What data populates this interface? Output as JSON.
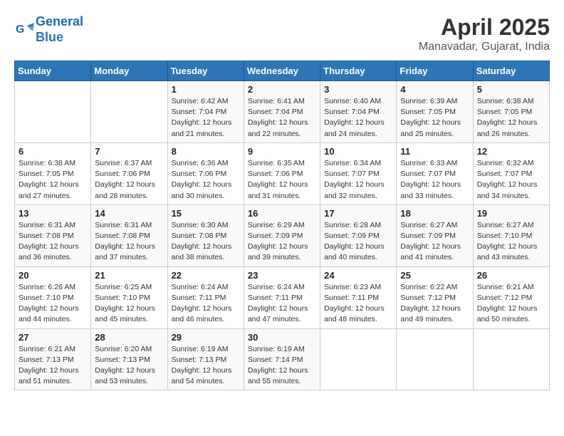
{
  "header": {
    "logo_line1": "General",
    "logo_line2": "Blue",
    "month": "April 2025",
    "location": "Manavadar, Gujarat, India"
  },
  "weekdays": [
    "Sunday",
    "Monday",
    "Tuesday",
    "Wednesday",
    "Thursday",
    "Friday",
    "Saturday"
  ],
  "weeks": [
    [
      {
        "day": "",
        "info": ""
      },
      {
        "day": "",
        "info": ""
      },
      {
        "day": "1",
        "info": "Sunrise: 6:42 AM\nSunset: 7:04 PM\nDaylight: 12 hours\nand 21 minutes."
      },
      {
        "day": "2",
        "info": "Sunrise: 6:41 AM\nSunset: 7:04 PM\nDaylight: 12 hours\nand 22 minutes."
      },
      {
        "day": "3",
        "info": "Sunrise: 6:40 AM\nSunset: 7:04 PM\nDaylight: 12 hours\nand 24 minutes."
      },
      {
        "day": "4",
        "info": "Sunrise: 6:39 AM\nSunset: 7:05 PM\nDaylight: 12 hours\nand 25 minutes."
      },
      {
        "day": "5",
        "info": "Sunrise: 6:38 AM\nSunset: 7:05 PM\nDaylight: 12 hours\nand 26 minutes."
      }
    ],
    [
      {
        "day": "6",
        "info": "Sunrise: 6:38 AM\nSunset: 7:05 PM\nDaylight: 12 hours\nand 27 minutes."
      },
      {
        "day": "7",
        "info": "Sunrise: 6:37 AM\nSunset: 7:06 PM\nDaylight: 12 hours\nand 28 minutes."
      },
      {
        "day": "8",
        "info": "Sunrise: 6:36 AM\nSunset: 7:06 PM\nDaylight: 12 hours\nand 30 minutes."
      },
      {
        "day": "9",
        "info": "Sunrise: 6:35 AM\nSunset: 7:06 PM\nDaylight: 12 hours\nand 31 minutes."
      },
      {
        "day": "10",
        "info": "Sunrise: 6:34 AM\nSunset: 7:07 PM\nDaylight: 12 hours\nand 32 minutes."
      },
      {
        "day": "11",
        "info": "Sunrise: 6:33 AM\nSunset: 7:07 PM\nDaylight: 12 hours\nand 33 minutes."
      },
      {
        "day": "12",
        "info": "Sunrise: 6:32 AM\nSunset: 7:07 PM\nDaylight: 12 hours\nand 34 minutes."
      }
    ],
    [
      {
        "day": "13",
        "info": "Sunrise: 6:31 AM\nSunset: 7:08 PM\nDaylight: 12 hours\nand 36 minutes."
      },
      {
        "day": "14",
        "info": "Sunrise: 6:31 AM\nSunset: 7:08 PM\nDaylight: 12 hours\nand 37 minutes."
      },
      {
        "day": "15",
        "info": "Sunrise: 6:30 AM\nSunset: 7:08 PM\nDaylight: 12 hours\nand 38 minutes."
      },
      {
        "day": "16",
        "info": "Sunrise: 6:29 AM\nSunset: 7:09 PM\nDaylight: 12 hours\nand 39 minutes."
      },
      {
        "day": "17",
        "info": "Sunrise: 6:28 AM\nSunset: 7:09 PM\nDaylight: 12 hours\nand 40 minutes."
      },
      {
        "day": "18",
        "info": "Sunrise: 6:27 AM\nSunset: 7:09 PM\nDaylight: 12 hours\nand 41 minutes."
      },
      {
        "day": "19",
        "info": "Sunrise: 6:27 AM\nSunset: 7:10 PM\nDaylight: 12 hours\nand 43 minutes."
      }
    ],
    [
      {
        "day": "20",
        "info": "Sunrise: 6:26 AM\nSunset: 7:10 PM\nDaylight: 12 hours\nand 44 minutes."
      },
      {
        "day": "21",
        "info": "Sunrise: 6:25 AM\nSunset: 7:10 PM\nDaylight: 12 hours\nand 45 minutes."
      },
      {
        "day": "22",
        "info": "Sunrise: 6:24 AM\nSunset: 7:11 PM\nDaylight: 12 hours\nand 46 minutes."
      },
      {
        "day": "23",
        "info": "Sunrise: 6:24 AM\nSunset: 7:11 PM\nDaylight: 12 hours\nand 47 minutes."
      },
      {
        "day": "24",
        "info": "Sunrise: 6:23 AM\nSunset: 7:11 PM\nDaylight: 12 hours\nand 48 minutes."
      },
      {
        "day": "25",
        "info": "Sunrise: 6:22 AM\nSunset: 7:12 PM\nDaylight: 12 hours\nand 49 minutes."
      },
      {
        "day": "26",
        "info": "Sunrise: 6:21 AM\nSunset: 7:12 PM\nDaylight: 12 hours\nand 50 minutes."
      }
    ],
    [
      {
        "day": "27",
        "info": "Sunrise: 6:21 AM\nSunset: 7:13 PM\nDaylight: 12 hours\nand 51 minutes."
      },
      {
        "day": "28",
        "info": "Sunrise: 6:20 AM\nSunset: 7:13 PM\nDaylight: 12 hours\nand 53 minutes."
      },
      {
        "day": "29",
        "info": "Sunrise: 6:19 AM\nSunset: 7:13 PM\nDaylight: 12 hours\nand 54 minutes."
      },
      {
        "day": "30",
        "info": "Sunrise: 6:19 AM\nSunset: 7:14 PM\nDaylight: 12 hours\nand 55 minutes."
      },
      {
        "day": "",
        "info": ""
      },
      {
        "day": "",
        "info": ""
      },
      {
        "day": "",
        "info": ""
      }
    ]
  ]
}
